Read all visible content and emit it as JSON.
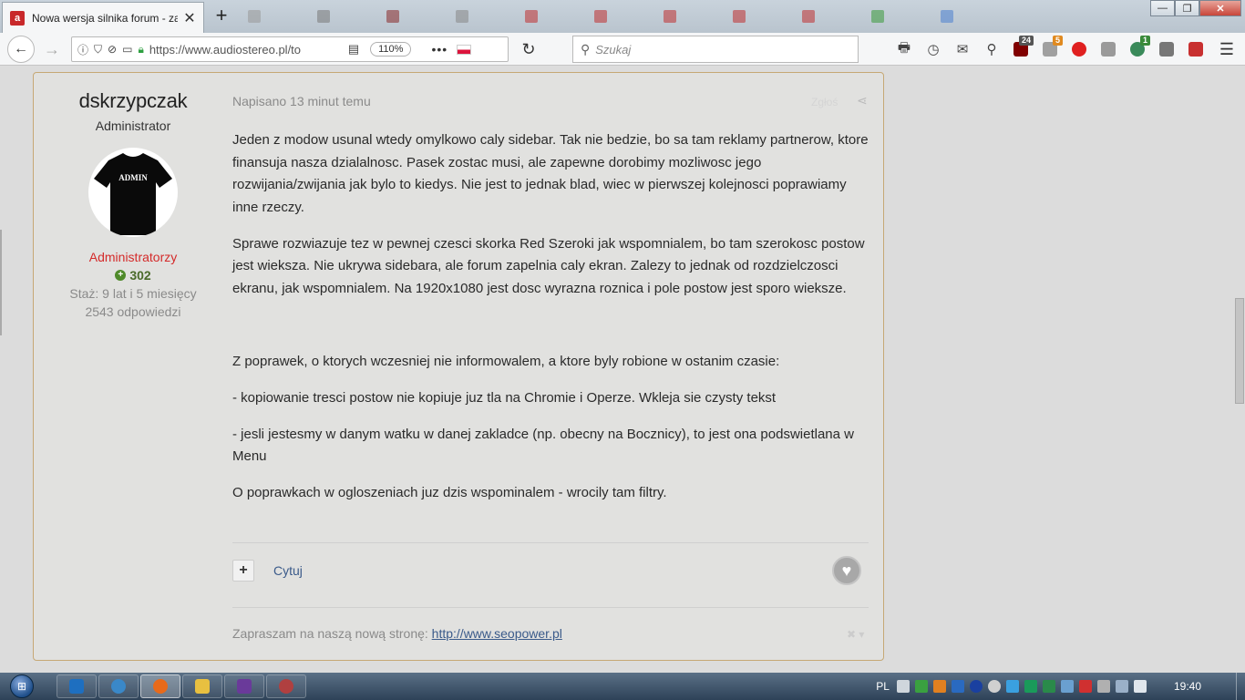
{
  "browser": {
    "tab_title": "Nowa wersja silnika forum - zap",
    "tab_favicon_letter": "a",
    "tab_close": "✕",
    "new_tab": "+",
    "url": "https://www.audiostereo.pl/to",
    "zoom": "110%",
    "page_actions": "•••",
    "search_placeholder": "Szukaj",
    "badges": {
      "ublock": "24",
      "ext2": "5",
      "ext3": "1"
    }
  },
  "post": {
    "author": {
      "name": "dskrzypczak",
      "role": "Administrator",
      "avatar_text": "ADMIN",
      "group": "Administratorzy",
      "reputation": "302",
      "reputation_icon": "+",
      "tenure": "Staż: 9 lat i 5 miesięcy",
      "replies": "2543 odpowiedzi"
    },
    "date": "Napisano 13 minut temu",
    "report": "Zgłoś",
    "paragraphs": {
      "p1": "Jeden z modow usunal wtedy omylkowo caly sidebar. Tak nie bedzie, bo sa tam reklamy partnerow, ktore finansuja nasza dzialalnosc. Pasek zostac musi, ale zapewne dorobimy mozliwosc jego rozwijania/zwijania jak bylo to kiedys. Nie jest to jednak blad, wiec w pierwszej kolejnosci poprawiamy inne rzeczy.",
      "p2": "Sprawe rozwiazuje tez w pewnej czesci skorka Red Szeroki jak wspomnialem, bo tam szerokosc postow jest wieksza. Nie ukrywa sidebara, ale forum zapelnia caly ekran. Zalezy to jednak od rozdzielczosci ekranu, jak wspomnialem. Na 1920x1080 jest dosc wyrazna roznica i pole postow jest sporo wieksze.",
      "p3": "Z poprawek, o ktorych wczesniej nie informowalem, a ktore byly robione w ostanim czasie:",
      "p4": "- kopiowanie tresci postow nie kopiuje juz tla na Chromie i Operze. Wkleja sie czysty tekst",
      "p5": "- jesli jestesmy w danym watku w danej zakladce (np. obecny na Bocznicy), to jest ona podswietlana w Menu",
      "p6": "O poprawkach w ogloszeniach juz dzis wspominalem - wrocily tam filtry."
    },
    "actions": {
      "plus": "+",
      "quote": "Cytuj"
    },
    "signature": {
      "text": "Zapraszam na naszą nową stronę: ",
      "link": "http://www.seopower.pl",
      "close": "✖ ▾"
    }
  },
  "taskbar": {
    "language": "PL",
    "clock": "19:40"
  },
  "colors": {
    "post_border": "#c6a875",
    "group_red": "#d42a2a",
    "link_blue": "#3a5a8a",
    "rep_green": "#4f8a2a"
  }
}
